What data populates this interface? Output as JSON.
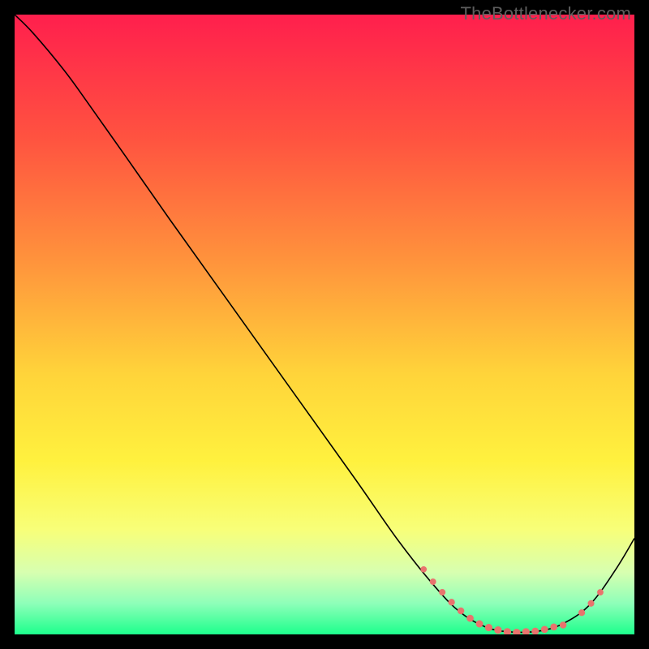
{
  "watermark": "TheBottlenecker.com",
  "chart_data": {
    "type": "line",
    "title": "",
    "xlabel": "",
    "ylabel": "",
    "xlim": [
      0,
      100
    ],
    "ylim": [
      0,
      100
    ],
    "background_gradient": {
      "stops": [
        {
          "offset": 0.0,
          "color": "#ff1f4d"
        },
        {
          "offset": 0.2,
          "color": "#ff5340"
        },
        {
          "offset": 0.4,
          "color": "#ff943c"
        },
        {
          "offset": 0.58,
          "color": "#ffd43a"
        },
        {
          "offset": 0.72,
          "color": "#fff13e"
        },
        {
          "offset": 0.83,
          "color": "#f8ff78"
        },
        {
          "offset": 0.9,
          "color": "#d7ffb0"
        },
        {
          "offset": 0.95,
          "color": "#8effb9"
        },
        {
          "offset": 1.0,
          "color": "#1dff8c"
        }
      ]
    },
    "curve": [
      {
        "x": 0.0,
        "y": 100.0
      },
      {
        "x": 3.0,
        "y": 97.0
      },
      {
        "x": 8.0,
        "y": 91.0
      },
      {
        "x": 12.0,
        "y": 85.5
      },
      {
        "x": 18.0,
        "y": 77.0
      },
      {
        "x": 25.0,
        "y": 67.0
      },
      {
        "x": 35.0,
        "y": 53.0
      },
      {
        "x": 45.0,
        "y": 39.0
      },
      {
        "x": 55.0,
        "y": 25.0
      },
      {
        "x": 62.0,
        "y": 15.0
      },
      {
        "x": 68.0,
        "y": 7.5
      },
      {
        "x": 72.0,
        "y": 3.5
      },
      {
        "x": 76.0,
        "y": 1.2
      },
      {
        "x": 80.0,
        "y": 0.4
      },
      {
        "x": 85.0,
        "y": 0.6
      },
      {
        "x": 89.0,
        "y": 2.0
      },
      {
        "x": 93.0,
        "y": 5.0
      },
      {
        "x": 97.0,
        "y": 10.5
      },
      {
        "x": 100.0,
        "y": 15.5
      }
    ],
    "markers": [
      {
        "x": 66.0,
        "y": 10.5
      },
      {
        "x": 67.5,
        "y": 8.5
      },
      {
        "x": 69.0,
        "y": 6.8
      },
      {
        "x": 70.5,
        "y": 5.2
      },
      {
        "x": 72.0,
        "y": 3.8
      },
      {
        "x": 73.5,
        "y": 2.6
      },
      {
        "x": 75.0,
        "y": 1.7
      },
      {
        "x": 76.5,
        "y": 1.1
      },
      {
        "x": 78.0,
        "y": 0.7
      },
      {
        "x": 79.5,
        "y": 0.4
      },
      {
        "x": 81.0,
        "y": 0.3
      },
      {
        "x": 82.5,
        "y": 0.4
      },
      {
        "x": 84.0,
        "y": 0.5
      },
      {
        "x": 85.5,
        "y": 0.8
      },
      {
        "x": 87.0,
        "y": 1.2
      },
      {
        "x": 88.5,
        "y": 1.5
      },
      {
        "x": 91.5,
        "y": 3.5
      },
      {
        "x": 93.0,
        "y": 5.0
      },
      {
        "x": 94.5,
        "y": 6.8
      }
    ],
    "marker_style": {
      "fill": "#e9736d",
      "radius_base": 4.8,
      "radius_min": 3.2
    },
    "line_style": {
      "stroke": "#000000",
      "width": 1.6
    }
  }
}
